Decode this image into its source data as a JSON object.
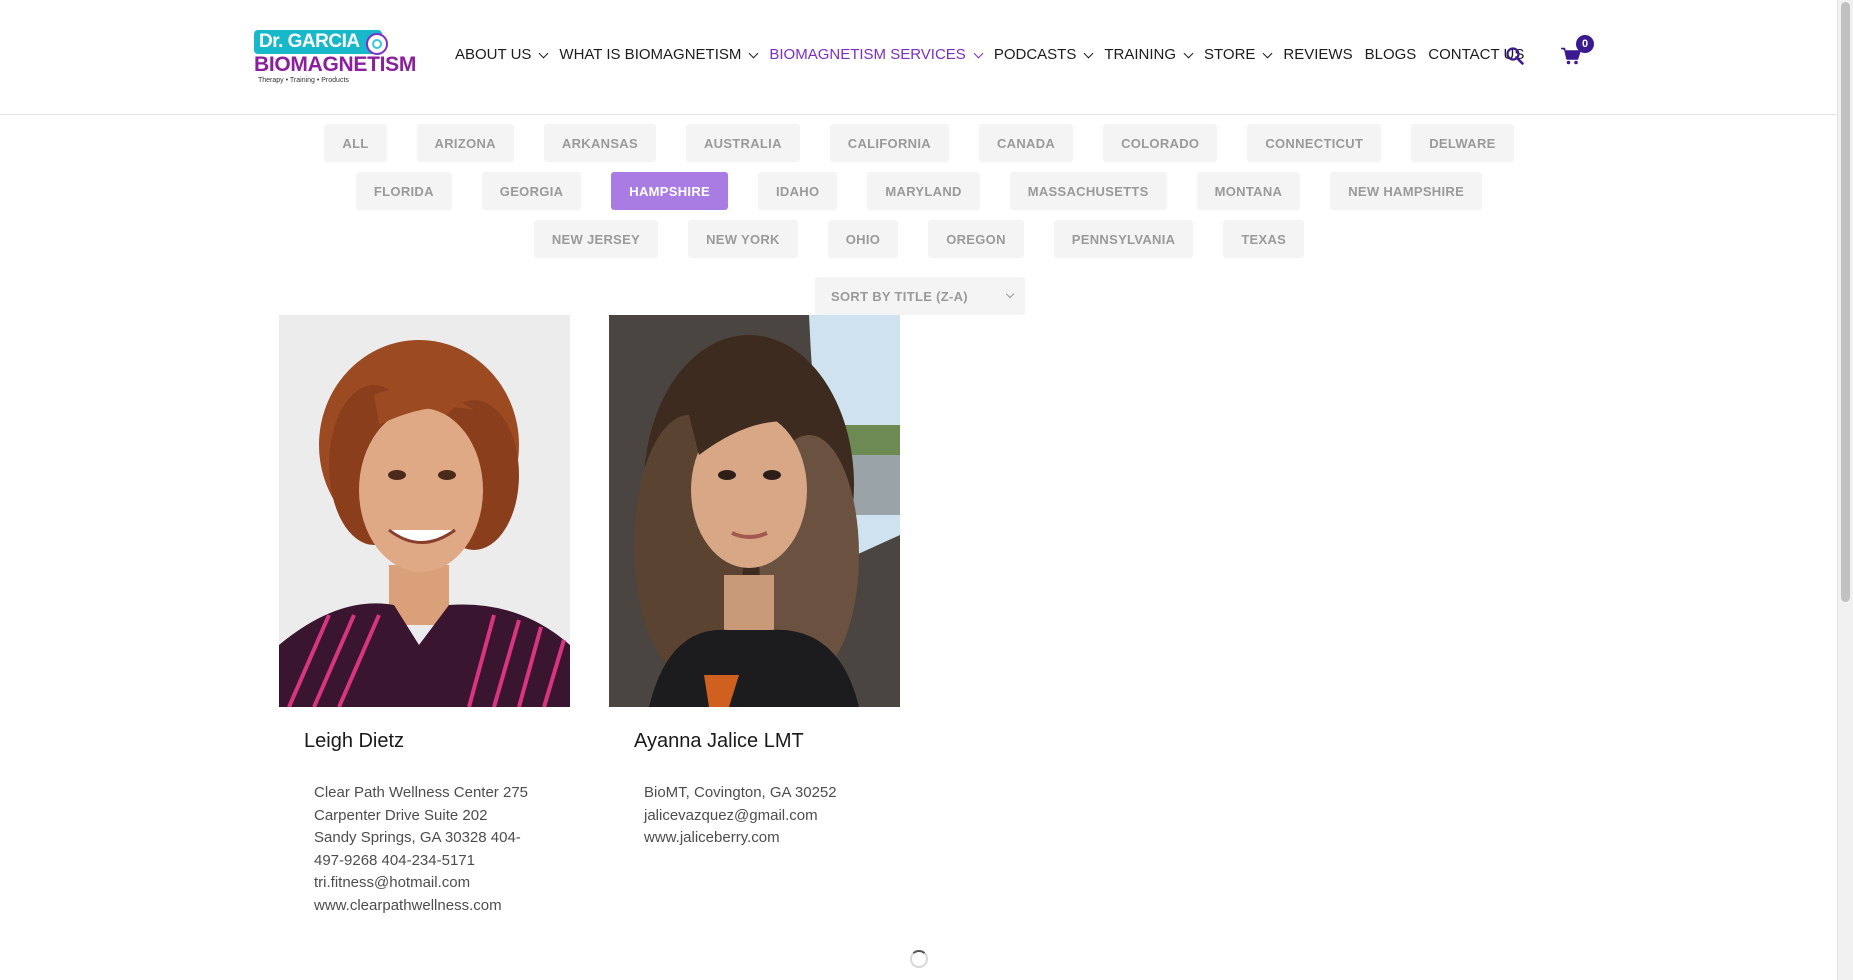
{
  "logo": {
    "top_text": "Dr. GARCIA",
    "main_text": "BIOMAGNETISM",
    "tagline": "Therapy • Training • Products"
  },
  "nav": {
    "items": [
      {
        "label": "ABOUT US",
        "dropdown": true
      },
      {
        "label": "WHAT IS BIOMAGNETISM",
        "dropdown": true
      },
      {
        "label": "BIOMAGNETISM SERVICES",
        "dropdown": true,
        "active": true
      },
      {
        "label": "PODCASTS",
        "dropdown": true
      },
      {
        "label": "TRAINING",
        "dropdown": true
      },
      {
        "label": "STORE",
        "dropdown": true
      },
      {
        "label": "REVIEWS",
        "dropdown": false
      },
      {
        "label": "BLOGS",
        "dropdown": false
      },
      {
        "label": "CONTACT US",
        "dropdown": false
      }
    ],
    "search_icon": "search-icon",
    "cart_icon": "cart-icon",
    "cart_count": "0"
  },
  "colors": {
    "accent": "#7a2fc4",
    "filter_active": "#a97ce4",
    "badge": "#3b1a8f"
  },
  "filters": {
    "rows": [
      [
        "ALL",
        "ARIZONA",
        "ARKANSAS",
        "AUSTRALIA",
        "CALIFORNIA",
        "CANADA",
        "COLORADO",
        "CONNECTICUT",
        "DELWARE"
      ],
      [
        "FLORIDA",
        "GEORGIA",
        "HAMPSHIRE",
        "IDAHO",
        "MARYLAND",
        "MASSACHUSETTS",
        "MONTANA",
        "NEW HAMPSHIRE"
      ],
      [
        "NEW JERSEY",
        "NEW YORK",
        "OHIO",
        "OREGON",
        "PENNSYLVANIA",
        "TEXAS"
      ]
    ],
    "active": "HAMPSHIRE"
  },
  "sort": {
    "label": "SORT BY TITLE (Z-A)"
  },
  "cards": [
    {
      "name": "Leigh Dietz",
      "info": [
        "Clear Path Wellness Center 275",
        "Carpenter Drive Suite 202",
        "Sandy Springs, GA 30328 404-",
        "497-9268 404-234-5171",
        "tri.fitness@hotmail.com",
        "www.clearpathwellness.com"
      ]
    },
    {
      "name": "Ayanna Jalice LMT",
      "info": [
        "BioMT, Covington, GA 30252",
        "jalicevazquez@gmail.com",
        "www.jaliceberry.com"
      ]
    }
  ]
}
